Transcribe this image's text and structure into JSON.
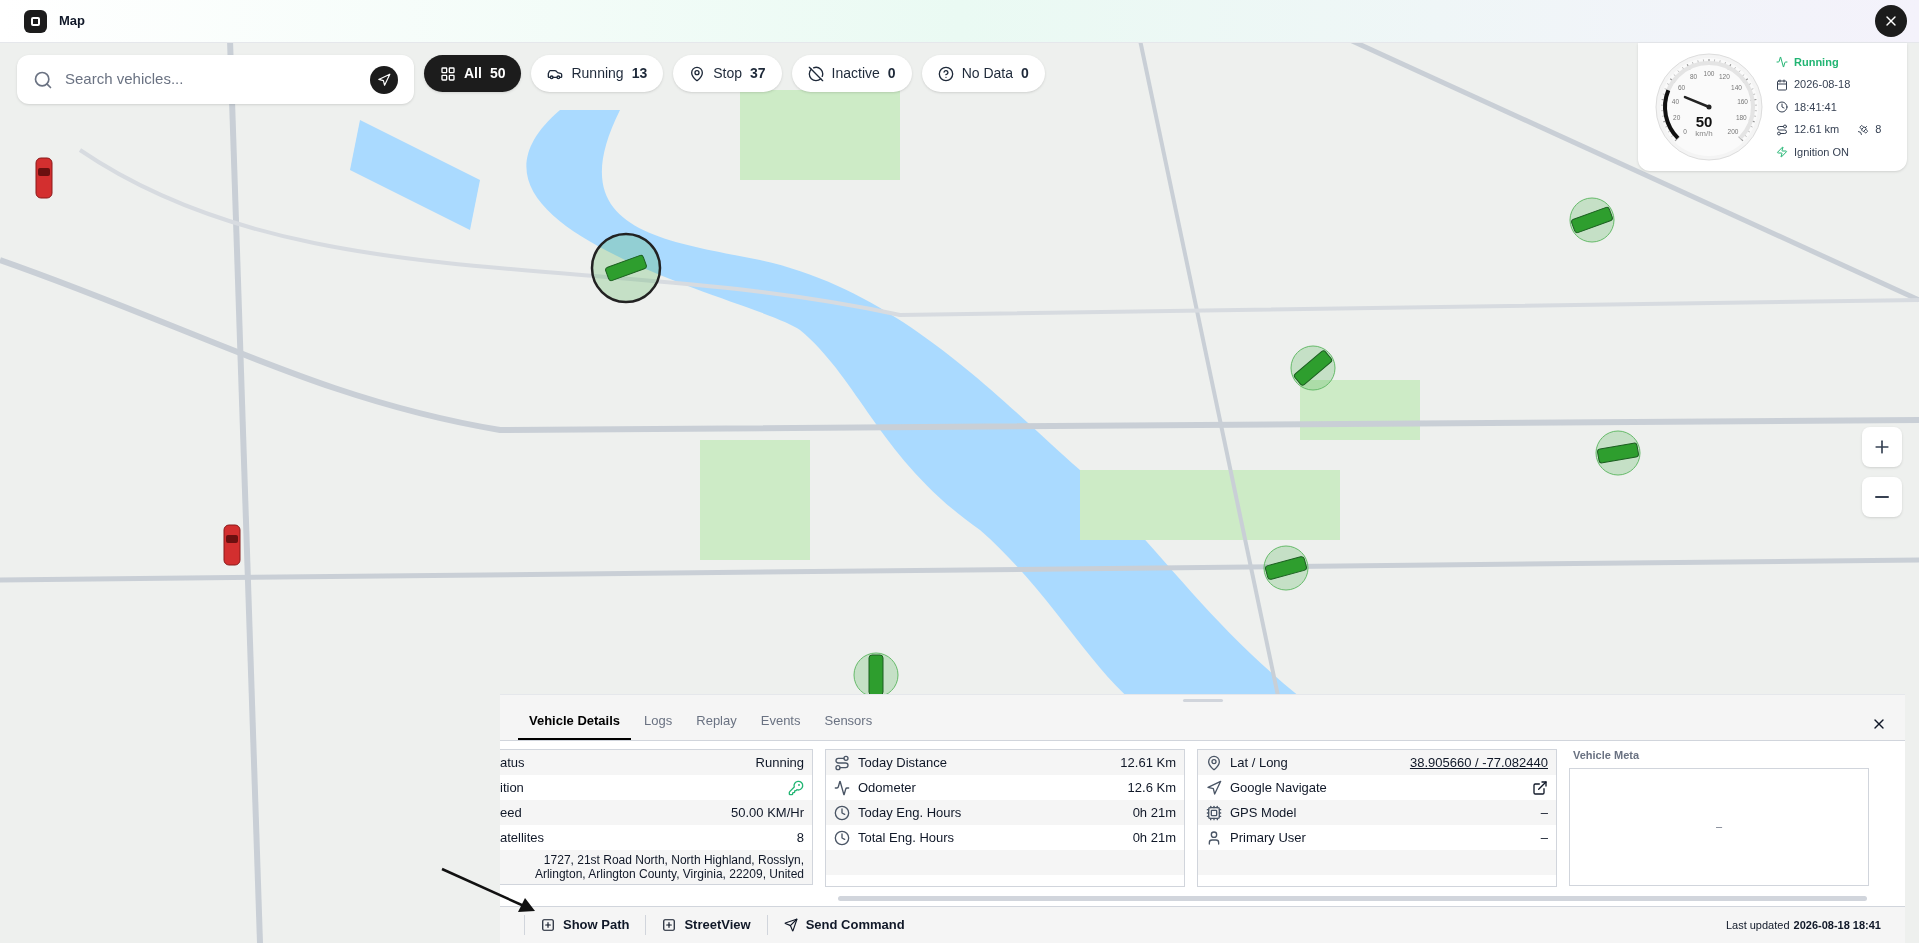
{
  "header": {
    "title": "Map"
  },
  "search": {
    "placeholder": "Search vehicles..."
  },
  "filters": [
    {
      "kind": "all",
      "label": "All",
      "count": "50",
      "selected": true
    },
    {
      "kind": "running",
      "label": "Running",
      "count": "13",
      "selected": false
    },
    {
      "kind": "stop",
      "label": "Stop",
      "count": "37",
      "selected": false
    },
    {
      "kind": "inactive",
      "label": "Inactive",
      "count": "0",
      "selected": false
    },
    {
      "kind": "nodata",
      "label": "No Data",
      "count": "0",
      "selected": false
    }
  ],
  "speed_widget": {
    "gauge_labels": [
      "0",
      "20",
      "40",
      "60",
      "80",
      "100",
      "120",
      "140",
      "160",
      "180",
      "200"
    ],
    "speed": "50",
    "unit": "km/h",
    "status": "Running",
    "date": "2026-08-18",
    "time": "18:41:41",
    "distance": "12.61 km",
    "satellites": "8",
    "ignition": "Ignition ON"
  },
  "panel": {
    "tabs": [
      {
        "label": "Vehicle Details",
        "selected": true
      },
      {
        "label": "Logs",
        "selected": false
      },
      {
        "label": "Replay",
        "selected": false
      },
      {
        "label": "Events",
        "selected": false
      },
      {
        "label": "Sensors",
        "selected": false
      }
    ],
    "status_table": [
      {
        "label": "atus",
        "kind": "text",
        "value": "Running"
      },
      {
        "label": "ition",
        "kind": "key"
      },
      {
        "label": "eed",
        "kind": "text",
        "value": "50.00 KM/Hr"
      },
      {
        "label": "atellites",
        "kind": "text",
        "value": "8"
      }
    ],
    "address": "1727, 21st Road North, North Highland, Rosslyn, Arlington, Arlington County, Virginia, 22209, United",
    "trip_table": [
      {
        "label": "Today Distance",
        "value": "12.61 Km"
      },
      {
        "label": "Odometer",
        "value": "12.6 Km"
      },
      {
        "label": "Today Eng. Hours",
        "value": "0h 21m"
      },
      {
        "label": "Total Eng. Hours",
        "value": "0h 21m"
      }
    ],
    "location_table": [
      {
        "label": "Lat / Long",
        "kind": "link",
        "value": "38.905660 / -77.082440"
      },
      {
        "label": "Google Navigate",
        "kind": "external"
      },
      {
        "label": "GPS Model",
        "kind": "text",
        "value": "–"
      },
      {
        "label": "Primary User",
        "kind": "text",
        "value": "–"
      }
    ],
    "meta": {
      "title": "Vehicle Meta",
      "value": "–"
    },
    "actions": [
      {
        "kind": "plus",
        "label": "Show Path"
      },
      {
        "kind": "plus",
        "label": "StreetView"
      },
      {
        "kind": "send",
        "label": "Send Command"
      }
    ],
    "last_updated_label": "Last updated",
    "last_updated": "2026-08-18 18:41"
  }
}
